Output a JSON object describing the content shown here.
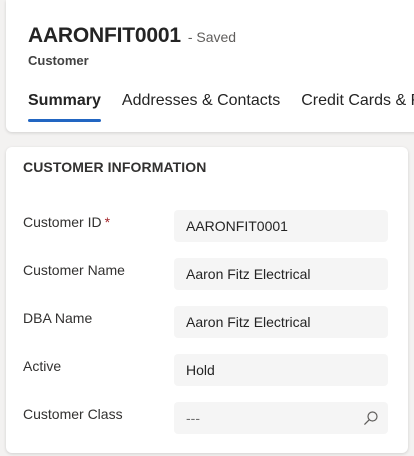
{
  "header": {
    "record_title": "AARONFIT0001",
    "save_status": "- Saved",
    "entity_type": "Customer",
    "tabs": [
      {
        "label": "Summary",
        "active": true
      },
      {
        "label": "Addresses & Contacts",
        "active": false
      },
      {
        "label": "Credit Cards & Re",
        "active": false
      }
    ]
  },
  "form": {
    "section_title": "CUSTOMER INFORMATION",
    "fields": [
      {
        "label": "Customer ID",
        "required_mark": "*",
        "value": "AARONFIT0001"
      },
      {
        "label": "Customer Name",
        "value": "Aaron Fitz Electrical"
      },
      {
        "label": "DBA Name",
        "value": "Aaron Fitz Electrical"
      },
      {
        "label": "Active",
        "value": "Hold"
      },
      {
        "label": "Customer Class",
        "value": "---",
        "icon": "search-icon"
      }
    ]
  },
  "colors": {
    "accent": "#2266c2",
    "required": "#a4262c",
    "field_background": "#f5f5f5",
    "page_background": "#f3f2f1"
  }
}
